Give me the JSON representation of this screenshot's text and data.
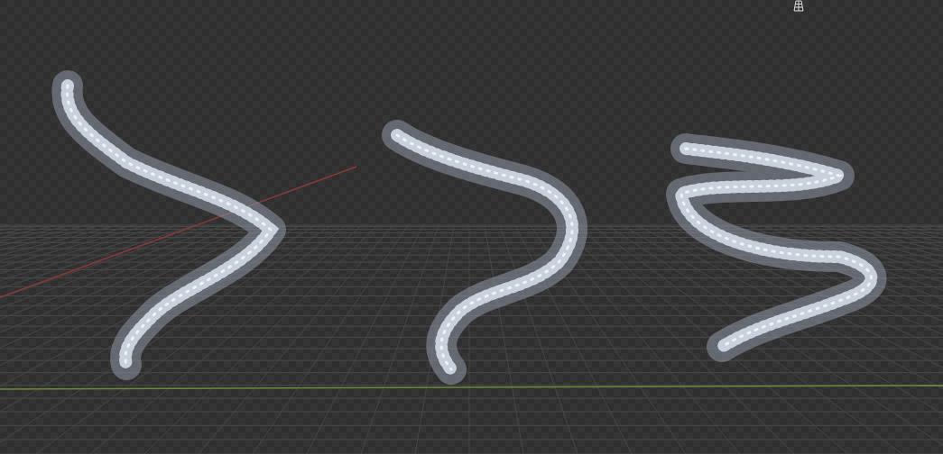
{
  "viewport": {
    "axes": [
      {
        "kind": "x-axis",
        "color": "#8a3a3a"
      },
      {
        "kind": "y-axis",
        "color": "#6a8a3a"
      }
    ],
    "objects": [
      {
        "kind": "splash"
      },
      {
        "kind": "splash"
      },
      {
        "kind": "splash"
      }
    ],
    "overlay_icons": [
      {
        "kind": "grid"
      }
    ]
  }
}
